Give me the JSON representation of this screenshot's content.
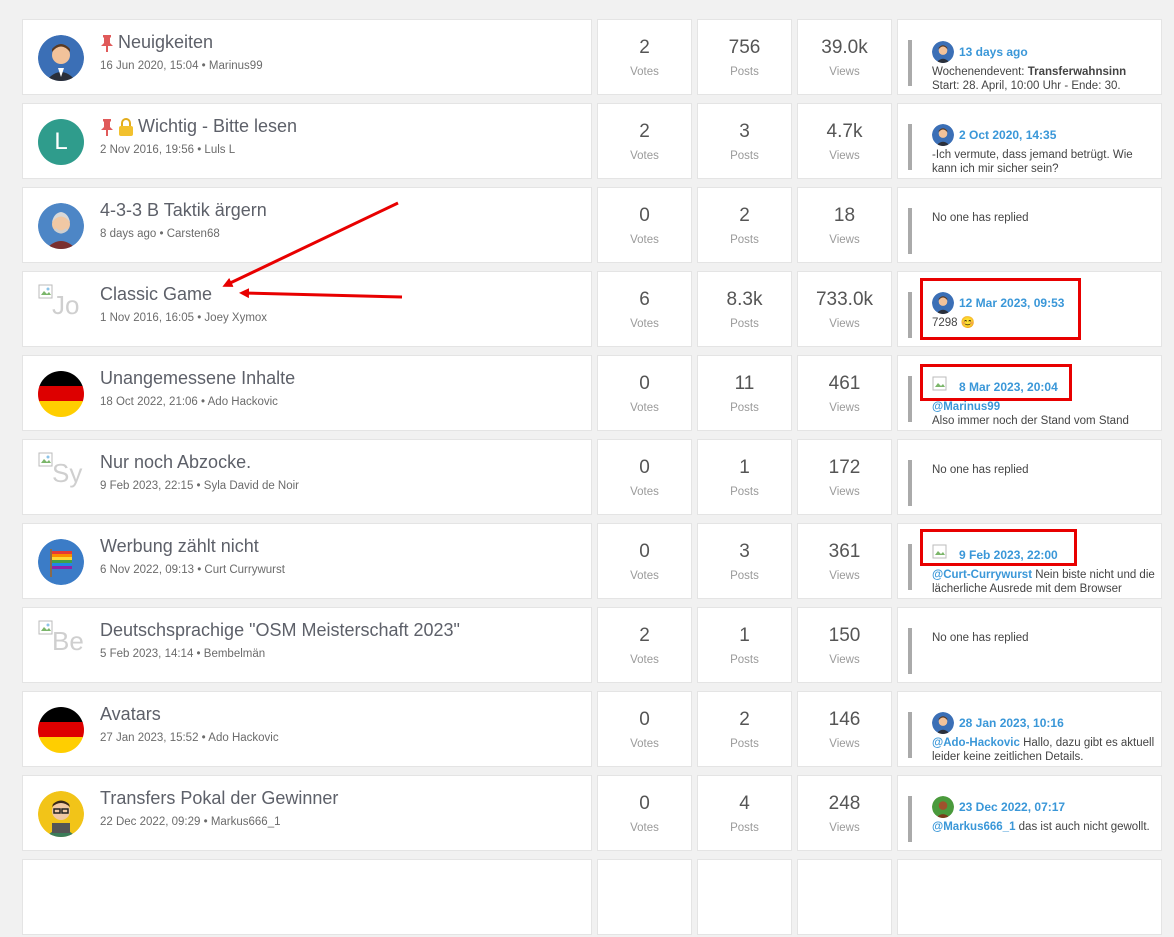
{
  "labels": {
    "votes": "Votes",
    "posts": "Posts",
    "views": "Views",
    "no_reply": "No one has replied"
  },
  "colors": {
    "accent": "#3a97d8",
    "annotation": "#e80000",
    "pin": "#e05a5a",
    "lock": "#f2c12e"
  },
  "topics": [
    {
      "title": "Neuigkeiten",
      "pinned": true,
      "locked": false,
      "date": "16 Jun 2020, 15:04",
      "author": "Marinus99",
      "avatar": "man-suit-icon",
      "votes": "2",
      "posts": "756",
      "views": "39.0k",
      "last_date": "13 days ago",
      "last_avatar": "man-suit-icon",
      "last_text_pre": "Wochenendevent: ",
      "last_text_bold": "Transferwahnsinn",
      "last_text_rest": "Start: 28. April, 10:00 Uhr - Ende: 30."
    },
    {
      "title": "Wichtig - Bitte lesen",
      "pinned": true,
      "locked": true,
      "date": "2 Nov 2016, 19:56",
      "author": "Luls L",
      "avatar_letter": "L",
      "votes": "2",
      "posts": "3",
      "views": "4.7k",
      "last_date": "2 Oct 2020, 14:35",
      "last_avatar": "man-suit-icon",
      "last_text": "-Ich vermute, dass jemand betrügt. Wie kann ich mir sicher sein?"
    },
    {
      "title": "4-3-3 B Taktik ärgern",
      "date": "8 days ago",
      "author": "Carsten68",
      "avatar": "old-man-icon",
      "votes": "0",
      "posts": "2",
      "views": "18"
    },
    {
      "title": "Classic Game",
      "date": "1 Nov 2016, 16:05",
      "author": "Joey Xymox",
      "avatar_alt": "Jo",
      "votes": "6",
      "posts": "8.3k",
      "views": "733.0k",
      "last_date": "12 Mar 2023, 09:53",
      "last_avatar": "man-suit-icon",
      "last_text": "7298",
      "last_emoji": "😊"
    },
    {
      "title": "Unangemessene Inhalte",
      "date": "18 Oct 2022, 21:06",
      "author": "Ado Hackovic",
      "avatar": "germany-flag-icon",
      "votes": "0",
      "posts": "11",
      "views": "461",
      "last_date": "8 Mar 2023, 20:04",
      "last_mention": "@Marinus99",
      "last_text": "Also immer noch der Stand vom Stand"
    },
    {
      "title": "Nur noch Abzocke.",
      "date": "9 Feb 2023, 22:15",
      "author": "Syla David de Noir",
      "avatar_alt": "Sy",
      "votes": "0",
      "posts": "1",
      "views": "172"
    },
    {
      "title": "Werbung zählt nicht",
      "date": "6 Nov 2022, 09:13",
      "author": "Curt Currywurst",
      "avatar": "rainbow-flag-icon",
      "votes": "0",
      "posts": "3",
      "views": "361",
      "last_date": "9 Feb 2023, 22:00",
      "last_mention": "@Curt-Currywurst",
      "last_text": " Nein biste nicht und die lächerliche Ausrede mit dem Browser"
    },
    {
      "title": "Deutschsprachige \"OSM Meisterschaft 2023\"",
      "date": "5 Feb 2023, 14:14",
      "author": "Bembelmän",
      "avatar_alt": "Be",
      "votes": "2",
      "posts": "1",
      "views": "150"
    },
    {
      "title": "Avatars",
      "date": "27 Jan 2023, 15:52",
      "author": "Ado Hackovic",
      "avatar": "germany-flag-icon",
      "votes": "0",
      "posts": "2",
      "views": "146",
      "last_date": "28 Jan 2023, 10:16",
      "last_avatar": "man-suit-icon",
      "last_mention": "@Ado-Hackovic",
      "last_text": " Hallo, dazu gibt es aktuell leider keine zeitlichen Details."
    },
    {
      "title": "Transfers Pokal der Gewinner",
      "date": "22 Dec 2022, 09:29",
      "author": "Markus666_1",
      "avatar": "glasses-man-icon",
      "votes": "0",
      "posts": "4",
      "views": "248",
      "last_date": "23 Dec 2022, 07:17",
      "last_avatar": "green-avatar-icon",
      "last_mention": "@Markus666_1",
      "last_text": " das ist auch nicht gewollt."
    }
  ]
}
